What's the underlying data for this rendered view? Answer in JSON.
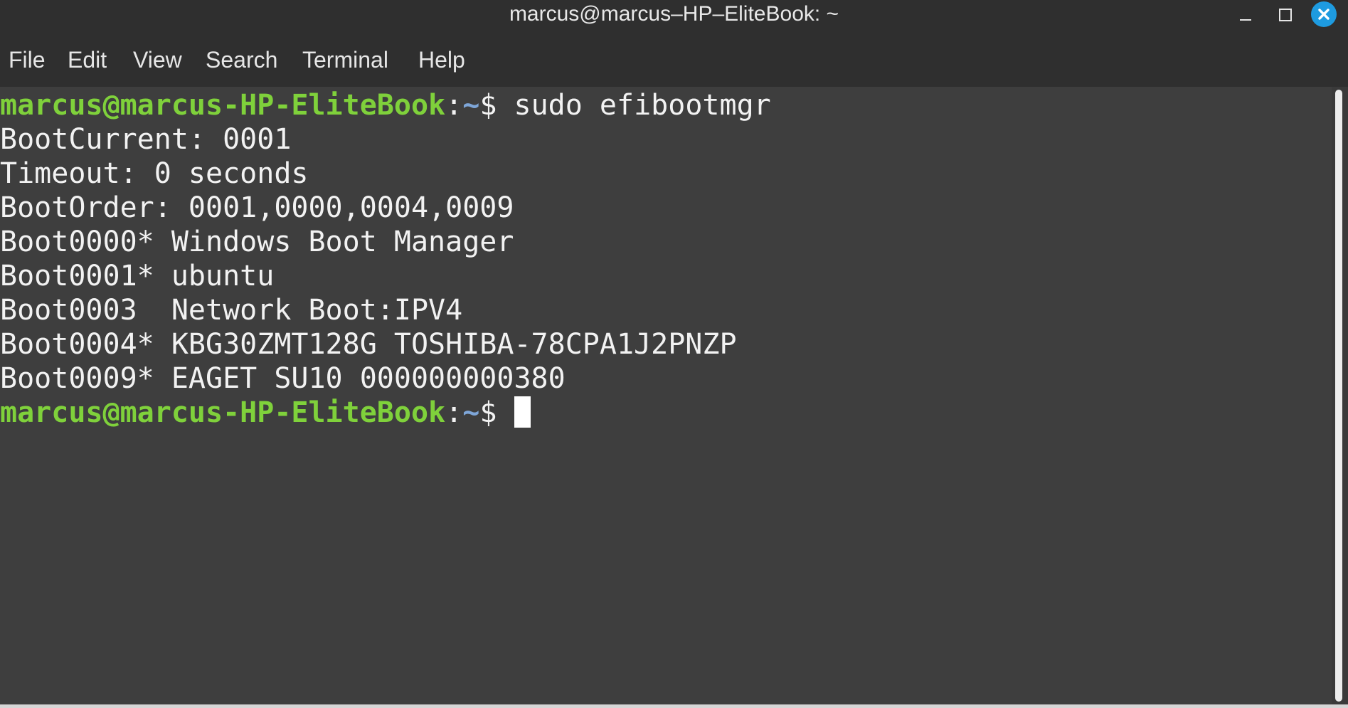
{
  "window": {
    "title": "marcus@marcus–HP–EliteBook: ~",
    "controls": {
      "minimize_icon": "minimize-icon",
      "maximize_icon": "maximize-icon",
      "close_icon": "close-icon",
      "close_color": "#1e9be0"
    }
  },
  "menu": {
    "items": [
      "File",
      "Edit",
      "View",
      "Search",
      "Terminal",
      "Help"
    ]
  },
  "terminal": {
    "colors": {
      "background": "#3e3e3e",
      "text": "#f2f2f2",
      "prompt_user": "#7fd13b",
      "prompt_path": "#7ea6d8"
    },
    "prompt": {
      "user_host": "marcus@marcus-HP-EliteBook",
      "separator": ":",
      "path": "~",
      "symbol": "$"
    },
    "command": "sudo efibootmgr",
    "output": [
      "BootCurrent: 0001",
      "Timeout: 0 seconds",
      "BootOrder: 0001,0000,0004,0009",
      "Boot0000* Windows Boot Manager",
      "Boot0001* ubuntu",
      "Boot0003  Network Boot:IPV4",
      "Boot0004* KBG30ZMT128G TOSHIBA-78CPA1J2PNZP",
      "Boot0009* EAGET SU10 000000000380"
    ]
  }
}
